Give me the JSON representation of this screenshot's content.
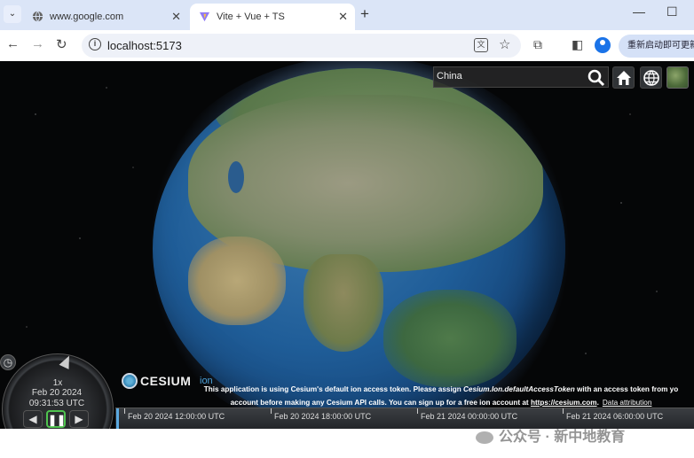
{
  "browser": {
    "tabs": [
      {
        "title": "www.google.com",
        "icon": "globe-icon",
        "active": false
      },
      {
        "title": "Vite + Vue + TS",
        "icon": "vite-logo-icon",
        "active": true
      }
    ],
    "new_tab_label": "+",
    "url": "localhost:5173",
    "update_button_label": "重新启动即可更新"
  },
  "viewer": {
    "geocoder": {
      "value": "China"
    },
    "toolbar_icons": [
      "search-icon",
      "home-icon",
      "globe-icon",
      "imagery-picker-icon"
    ],
    "animation": {
      "speed": "1x",
      "date": "Feb 20 2024",
      "time": "09:31:53 UTC"
    },
    "credit": {
      "logo_word": "CESIUM",
      "logo_ion": "ion",
      "line1_start": "This application is using Cesium's default ion access token. Please assign ",
      "line1_code": "Cesium.Ion.defaultAccessToken",
      "line1_end": " with an access token from yo",
      "line2_start": "account before making any Cesium API calls. You can sign up for a free ion account at ",
      "line2_link": "https://cesium.com",
      "line2_end": ".",
      "attribution": "Data attribution"
    },
    "timeline": {
      "labels": [
        "Feb 20 2024 12:00:00 UTC",
        "Feb 20 2024 18:00:00 UTC",
        "Feb 21 2024 00:00:00 UTC",
        "Feb 21 2024 06:00:00 UTC"
      ]
    }
  },
  "watermark": "公众号 · 新中地教育"
}
